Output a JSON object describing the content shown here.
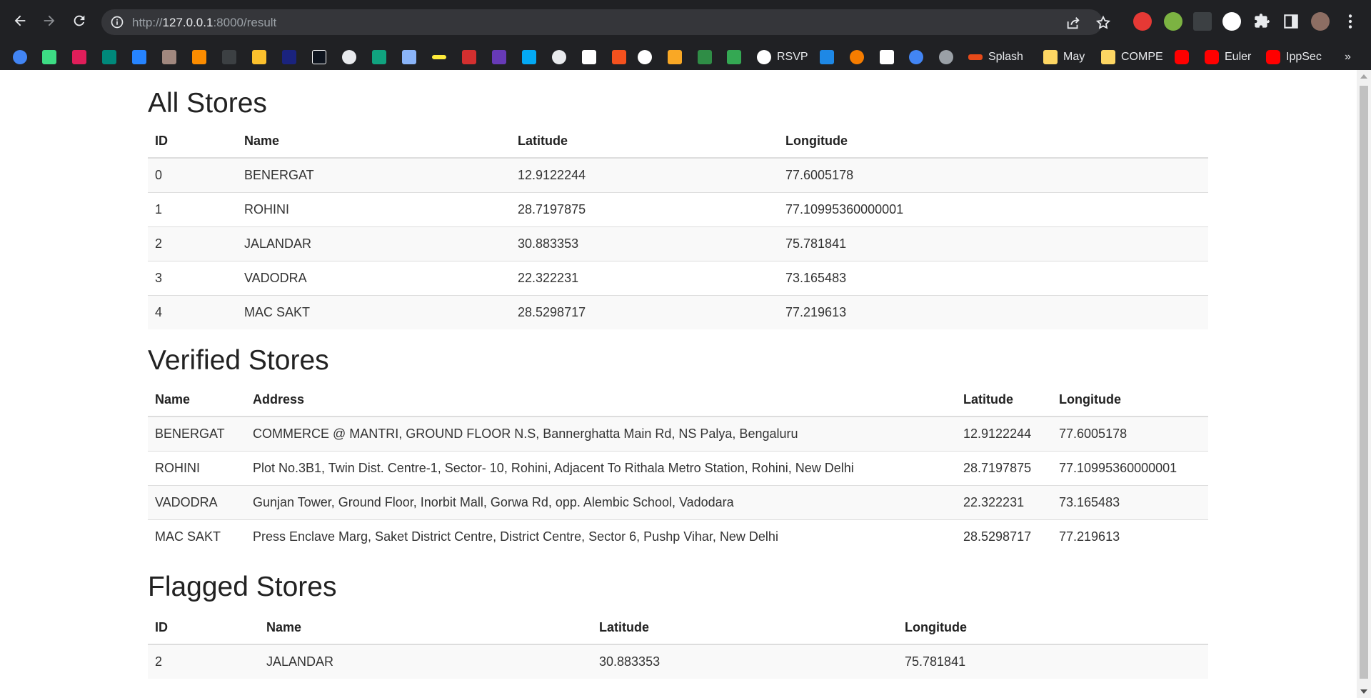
{
  "browser": {
    "url_prefix": "http://",
    "url_host": "127.0.0.1",
    "url_rest": ":8000/result",
    "bookmarks_labeled": [
      {
        "label": "RSVP"
      },
      {
        "label": "Splash"
      },
      {
        "label": "May"
      },
      {
        "label": "COMPE"
      },
      {
        "label": "Euler"
      },
      {
        "label": "IppSec"
      }
    ],
    "bookmarks_more": "»"
  },
  "all_stores": {
    "heading": "All Stores",
    "headers": [
      "ID",
      "Name",
      "Latitude",
      "Longitude"
    ],
    "rows": [
      [
        "0",
        "BENERGAT",
        "12.9122244",
        "77.6005178"
      ],
      [
        "1",
        "ROHINI",
        "28.7197875",
        "77.10995360000001"
      ],
      [
        "2",
        "JALANDAR",
        "30.883353",
        "75.781841"
      ],
      [
        "3",
        "VADODRA",
        "22.322231",
        "73.165483"
      ],
      [
        "4",
        "MAC SAKT",
        "28.5298717",
        "77.219613"
      ]
    ]
  },
  "verified_stores": {
    "heading": "Verified Stores",
    "headers": [
      "Name",
      "Address",
      "Latitude",
      "Longitude"
    ],
    "rows": [
      [
        "BENERGAT",
        "COMMERCE @ MANTRI, GROUND FLOOR N.S, Bannerghatta Main Rd, NS Palya, Bengaluru",
        "12.9122244",
        "77.6005178"
      ],
      [
        "ROHINI",
        "Plot No.3B1, Twin Dist. Centre-1, Sector- 10, Rohini, Adjacent To Rithala Metro Station, Rohini, New Delhi",
        "28.7197875",
        "77.10995360000001"
      ],
      [
        "VADODRA",
        "Gunjan Tower, Ground Floor, Inorbit Mall, Gorwa Rd, opp. Alembic School, Vadodara",
        "22.322231",
        "73.165483"
      ],
      [
        "MAC SAKT",
        "Press Enclave Marg, Saket District Centre, District Centre, Sector 6, Pushp Vihar, New Delhi",
        "28.5298717",
        "77.219613"
      ]
    ]
  },
  "flagged_stores": {
    "heading": "Flagged Stores",
    "headers": [
      "ID",
      "Name",
      "Latitude",
      "Longitude"
    ],
    "rows": [
      [
        "2",
        "JALANDAR",
        "30.883353",
        "75.781841"
      ]
    ]
  }
}
